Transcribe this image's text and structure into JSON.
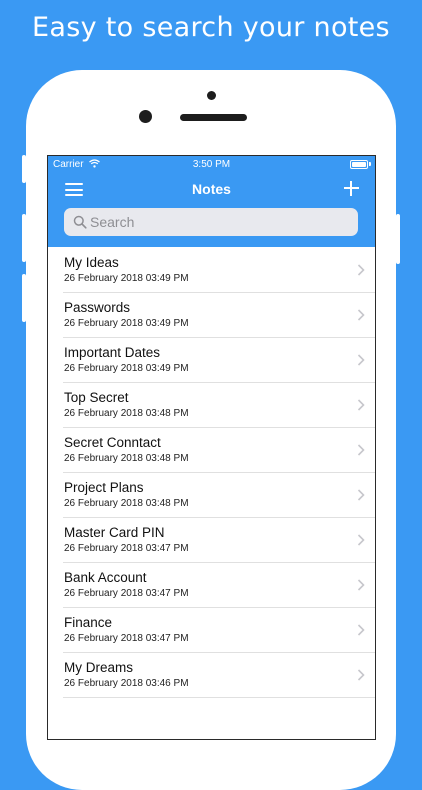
{
  "headline": "Easy to search your notes",
  "status_bar": {
    "carrier": "Carrier",
    "time": "3:50 PM"
  },
  "nav": {
    "title": "Notes"
  },
  "search": {
    "placeholder": "Search"
  },
  "notes": [
    {
      "title": "My Ideas",
      "date": "26 February 2018 03:49 PM"
    },
    {
      "title": "Passwords",
      "date": "26 February 2018 03:49 PM"
    },
    {
      "title": "Important Dates",
      "date": "26 February 2018 03:49 PM"
    },
    {
      "title": "Top Secret",
      "date": "26 February 2018 03:48 PM"
    },
    {
      "title": "Secret Conntact",
      "date": "26 February 2018 03:48 PM"
    },
    {
      "title": "Project Plans",
      "date": "26 February 2018 03:48 PM"
    },
    {
      "title": "Master Card PIN",
      "date": "26 February 2018 03:47 PM"
    },
    {
      "title": "Bank Account",
      "date": "26 February 2018 03:47 PM"
    },
    {
      "title": "Finance",
      "date": "26 February 2018 03:47 PM"
    },
    {
      "title": "My Dreams",
      "date": "26 February 2018 03:46 PM"
    }
  ],
  "colors": {
    "accent": "#3a99f3",
    "search_bg": "#e8e9ee",
    "separator": "#e0e0e0",
    "chevron": "#c7c7cc"
  },
  "icons": {
    "menu": "hamburger-menu-icon",
    "add": "plus-icon",
    "search": "magnifier-icon",
    "row_disclosure": "chevron-right-icon",
    "wifi": "wifi-icon",
    "battery": "battery-icon"
  }
}
